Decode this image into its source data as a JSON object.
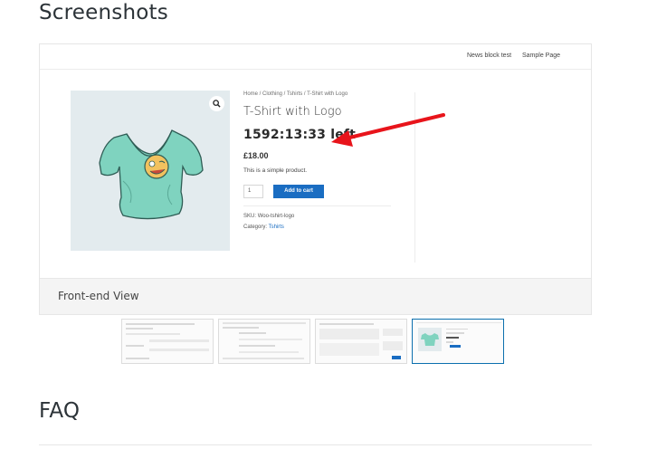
{
  "sections": {
    "screenshots_title": "Screenshots",
    "faq_title": "FAQ"
  },
  "preview": {
    "nav": [
      "News block test",
      "Sample Page"
    ],
    "breadcrumb": "Home / Clothing / Tshirts / T-Shirt with Logo",
    "product_title": "T-Shirt with Logo",
    "countdown": "1592:13:33 left",
    "price": "£18.00",
    "description": "This is a simple product.",
    "quantity": "1",
    "add_to_cart": "Add to cart",
    "sku_label": "SKU:",
    "sku_value": "Woo-tshirt-logo",
    "category_label": "Category:",
    "category_value": "Tshirts",
    "caption": "Front-end View",
    "icons": [
      "zoom-icon",
      "tshirt-image",
      "annotation-arrow"
    ]
  },
  "thumbnails": {
    "count": 4,
    "active_index": 3
  },
  "colors": {
    "accent_blue": "#1a6dc2",
    "arrow_red": "#e8141b",
    "shirt": "#7fd3bf",
    "image_bg": "#e3ebee"
  }
}
